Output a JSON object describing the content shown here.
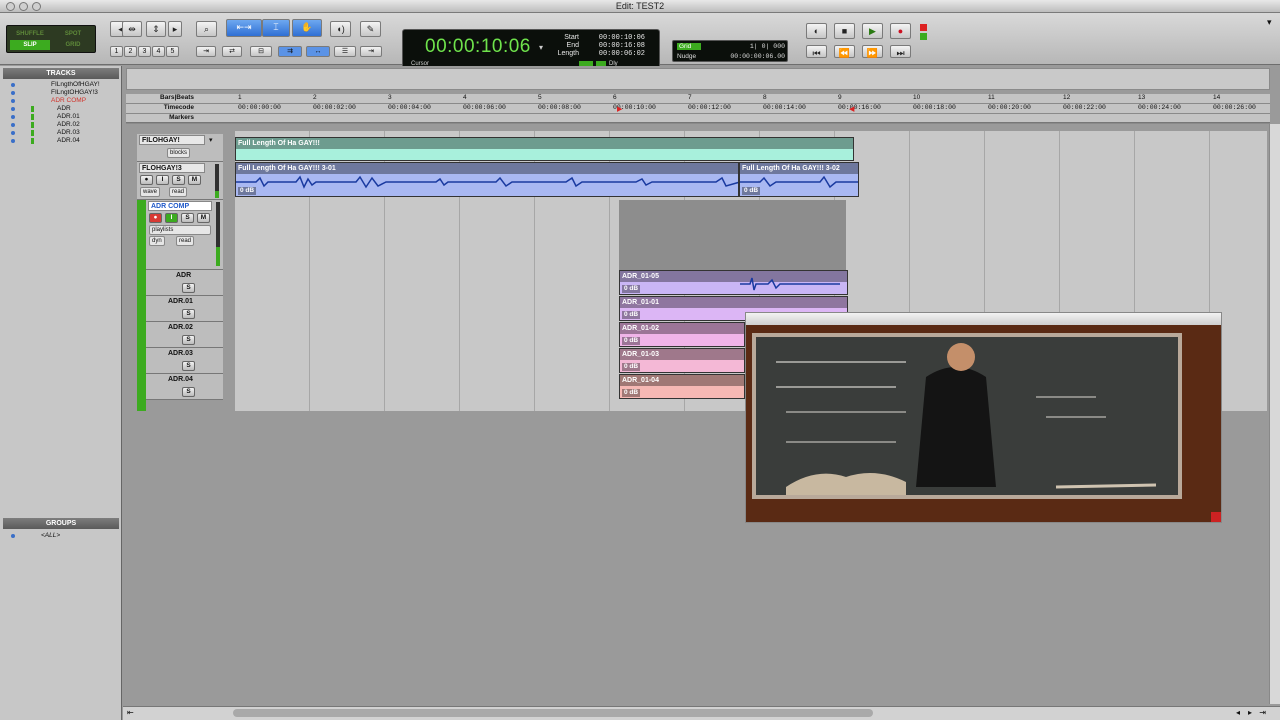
{
  "window": {
    "title": "Edit: TEST2"
  },
  "toolbar": {
    "modes": [
      "SHUFFLE",
      "SPOT",
      "SLIP",
      "GRID"
    ],
    "zoom_presets": [
      "1",
      "2",
      "3",
      "4",
      "5"
    ],
    "counter": {
      "main": "00:00:10:06",
      "start_label": "Start",
      "start": "00:00:10:06",
      "end_label": "End",
      "end": "00:00:16:08",
      "length_label": "Length",
      "length": "00:00:06:02",
      "cursor_label": "Cursor",
      "dly_label": "Dly"
    },
    "grid": {
      "grid_label": "Grid",
      "grid_value": "1| 0| 000",
      "nudge_label": "Nudge",
      "nudge_value": "00:00:00:06.00"
    }
  },
  "tracks_panel": {
    "title": "TRACKS",
    "items": [
      "FILngthOfHGAY!",
      "FILngtOHGAY!3",
      "ADR COMP",
      "ADR",
      "ADR.01",
      "ADR.02",
      "ADR.03",
      "ADR.04"
    ]
  },
  "groups_panel": {
    "title": "GROUPS",
    "items": [
      "<ALL>"
    ]
  },
  "rulers": {
    "bars_label": "Bars|Beats",
    "timecode_label": "Timecode",
    "markers_label": "Markers",
    "bars": [
      "1",
      "2",
      "3",
      "4",
      "5",
      "6",
      "7",
      "8",
      "9",
      "10",
      "11",
      "12",
      "13",
      "14"
    ],
    "timecodes": [
      "00:00:00:00",
      "00:00:02:00",
      "00:00:04:00",
      "00:00:06:00",
      "00:00:08:00",
      "00:00:10:00",
      "00:00:12:00",
      "00:00:14:00",
      "00:00:16:00",
      "00:00:18:00",
      "00:00:20:00",
      "00:00:22:00",
      "00:00:24:00",
      "00:00:26:00"
    ]
  },
  "tracks": {
    "t1": {
      "name": "FILOHGAY!",
      "view": "blocks"
    },
    "t2": {
      "name": "FLOHGAY!3",
      "view": "wave",
      "automation": "read",
      "btn_s": "S",
      "btn_m": "M"
    },
    "t3": {
      "name": "ADR COMP",
      "view": "playlists",
      "dyn": "dyn",
      "automation": "read",
      "btn_s": "S",
      "btn_m": "M"
    },
    "lanes": [
      {
        "name": "ADR",
        "s": "S"
      },
      {
        "name": "ADR.01",
        "s": "S"
      },
      {
        "name": "ADR.02",
        "s": "S"
      },
      {
        "name": "ADR.03",
        "s": "S"
      },
      {
        "name": "ADR.04",
        "s": "S"
      }
    ]
  },
  "clips": {
    "c1": {
      "name": "Full Length Of Ha GAY!!!"
    },
    "c2": {
      "name": "Full Length Of Ha GAY!!! 3-01",
      "gain": "0 dB"
    },
    "c3": {
      "name": "Full Length Of Ha GAY!!! 3-02",
      "gain": "0 dB"
    },
    "adr": [
      {
        "name": "ADR_01-05",
        "gain": "0 dB"
      },
      {
        "name": "ADR_01-01",
        "gain": "0 dB"
      },
      {
        "name": "ADR_01-02",
        "gain": "0 dB"
      },
      {
        "name": "ADR_01-03",
        "gain": "0 dB"
      },
      {
        "name": "ADR_01-04",
        "gain": "0 dB"
      }
    ]
  },
  "colors": {
    "cyan_clip": "#a8f0dc",
    "blue_clip": "#a9b8f2",
    "adr05": "#c9b6f5",
    "adr01": "#dcb6f5",
    "adr02": "#f0b4e8",
    "adr03": "#f4b8d6",
    "adr04": "#f6b8b4",
    "counter_green": "#6fe34c"
  }
}
